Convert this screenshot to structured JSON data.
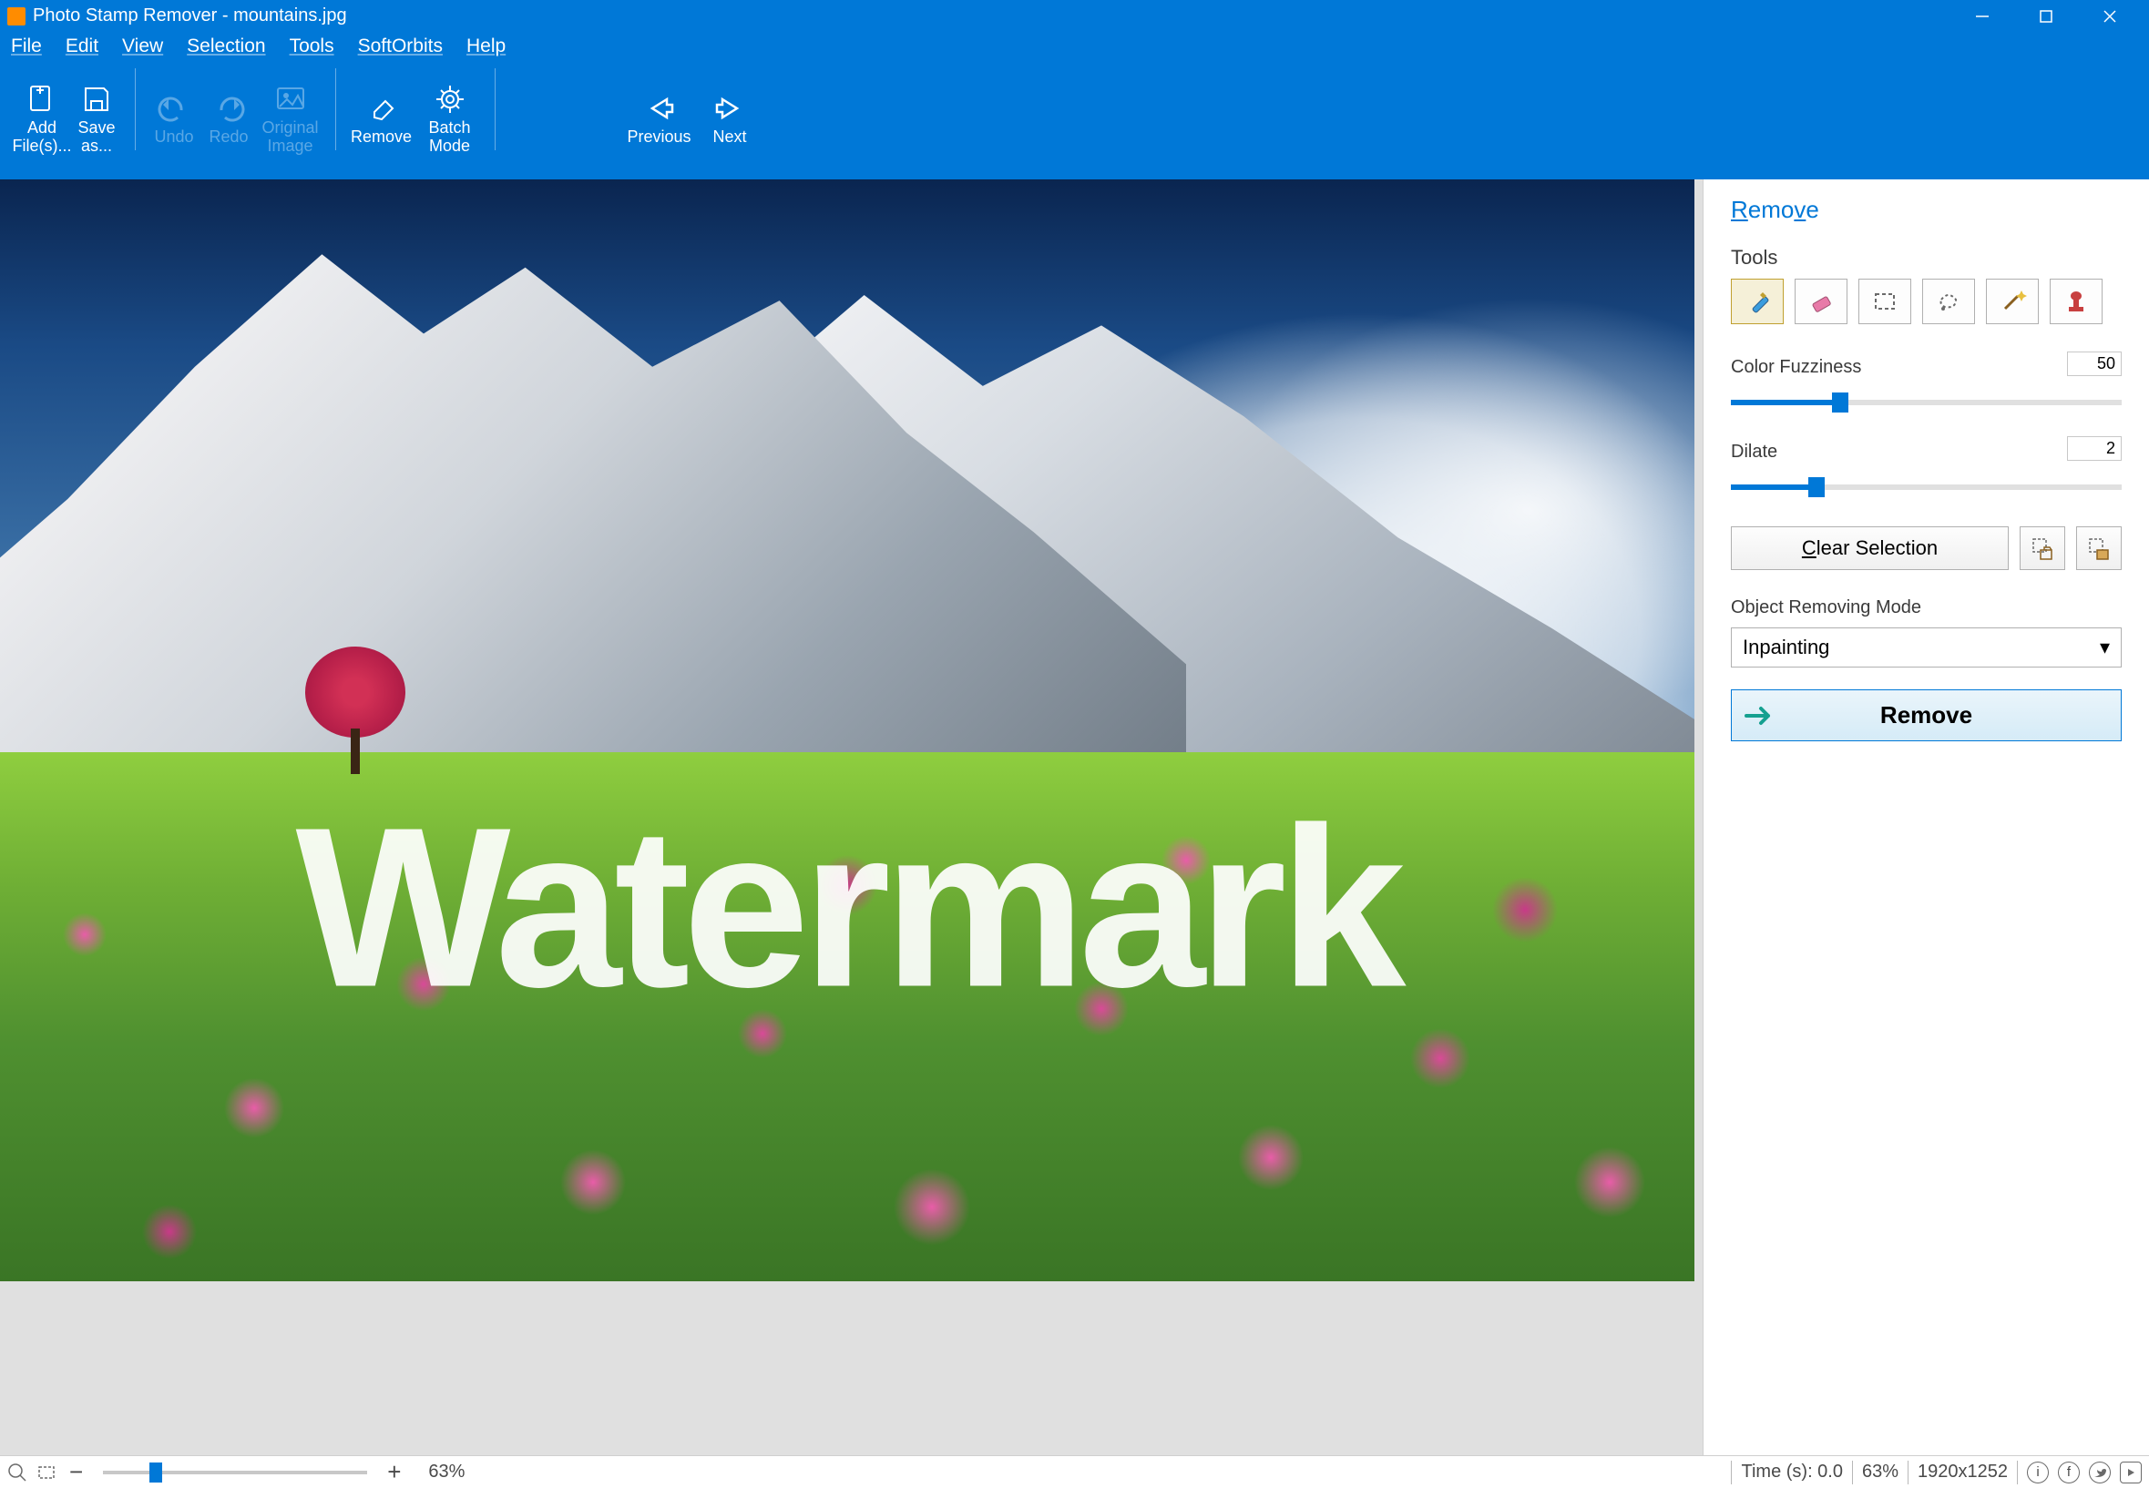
{
  "titlebar": {
    "title": "Photo Stamp Remover - mountains.jpg"
  },
  "menubar": {
    "file": "File",
    "edit": "Edit",
    "view": "View",
    "selection": "Selection",
    "tools": "Tools",
    "softorbits": "SoftOrbits",
    "help": "Help"
  },
  "ribbon": {
    "add_files": "Add File(s)...",
    "save_as": "Save as...",
    "undo": "Undo",
    "redo": "Redo",
    "original": "Original Image",
    "remove": "Remove",
    "batch": "Batch Mode",
    "previous": "Previous",
    "next": "Next"
  },
  "canvas": {
    "watermark_text": "Watermark"
  },
  "sidebar": {
    "tab": "Remove",
    "tools_label": "Tools",
    "color_fuzziness_label": "Color Fuzziness",
    "color_fuzziness_value": "50",
    "dilate_label": "Dilate",
    "dilate_value": "2",
    "clear_selection": "Clear Selection",
    "object_removing_mode_label": "Object Removing Mode",
    "object_removing_mode_value": "Inpainting",
    "remove_button": "Remove"
  },
  "statusbar": {
    "zoom_left": "63%",
    "time_label": "Time (s): 0.0",
    "zoom_right": "63%",
    "dimensions": "1920x1252"
  }
}
